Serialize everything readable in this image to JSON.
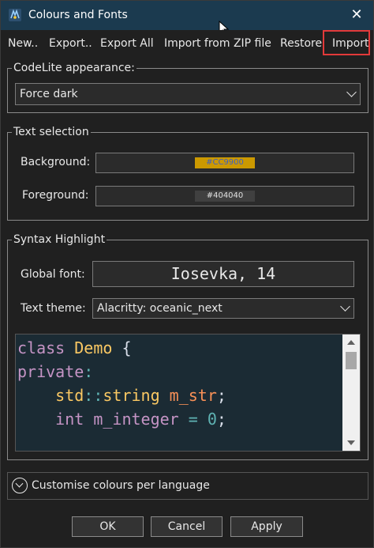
{
  "window": {
    "title": "Colours and Fonts",
    "close_glyph": "✕"
  },
  "toolbar": {
    "new_label": "New..",
    "export_label": "Export..",
    "export_all_label": "Export All",
    "import_zip_label": "Import from ZIP file",
    "restore_label": "Restore",
    "import_label": "Import"
  },
  "appearance": {
    "group_label": "CodeLite appearance:",
    "selected": "Force dark"
  },
  "text_selection": {
    "group_label": "Text selection",
    "background_label": "Background:",
    "background_value": "#CC9900",
    "background_color": "#cc9900",
    "background_text_color": "#4060c0",
    "foreground_label": "Foreground:",
    "foreground_value": "#404040",
    "foreground_color": "#404040",
    "foreground_text_color": "#e0e0e0"
  },
  "syntax": {
    "group_label": "Syntax Highlight",
    "global_font_label": "Global font:",
    "global_font_value": "Iosevka, 14",
    "text_theme_label": "Text theme:",
    "text_theme_value": "Alacritty: oceanic_next"
  },
  "preview": {
    "lines": [
      [
        {
          "t": "class ",
          "c": "kw"
        },
        {
          "t": "Demo",
          "c": "ty"
        },
        {
          "t": " {",
          "c": "pl"
        }
      ],
      [
        {
          "t": "private",
          "c": "kw"
        },
        {
          "t": ":",
          "c": "op"
        }
      ],
      [
        {
          "t": "    std",
          "c": "ty"
        },
        {
          "t": "::",
          "c": "op"
        },
        {
          "t": "string",
          "c": "ty"
        },
        {
          "t": " m_str",
          "c": "nu"
        },
        {
          "t": ";",
          "c": "pl"
        }
      ],
      [
        {
          "t": "    int",
          "c": "kw"
        },
        {
          "t": " m_integer",
          "c": "nm"
        },
        {
          "t": " = ",
          "c": "op"
        },
        {
          "t": "0",
          "c": "op"
        },
        {
          "t": ";",
          "c": "pl"
        }
      ]
    ]
  },
  "customise": {
    "label": "Customise colours per language"
  },
  "buttons": {
    "ok": "OK",
    "cancel": "Cancel",
    "apply": "Apply"
  },
  "colors": {
    "title_bar": "#1b3a4f",
    "highlight_border": "#e23a3a",
    "editor_bg": "#1b2b34"
  }
}
